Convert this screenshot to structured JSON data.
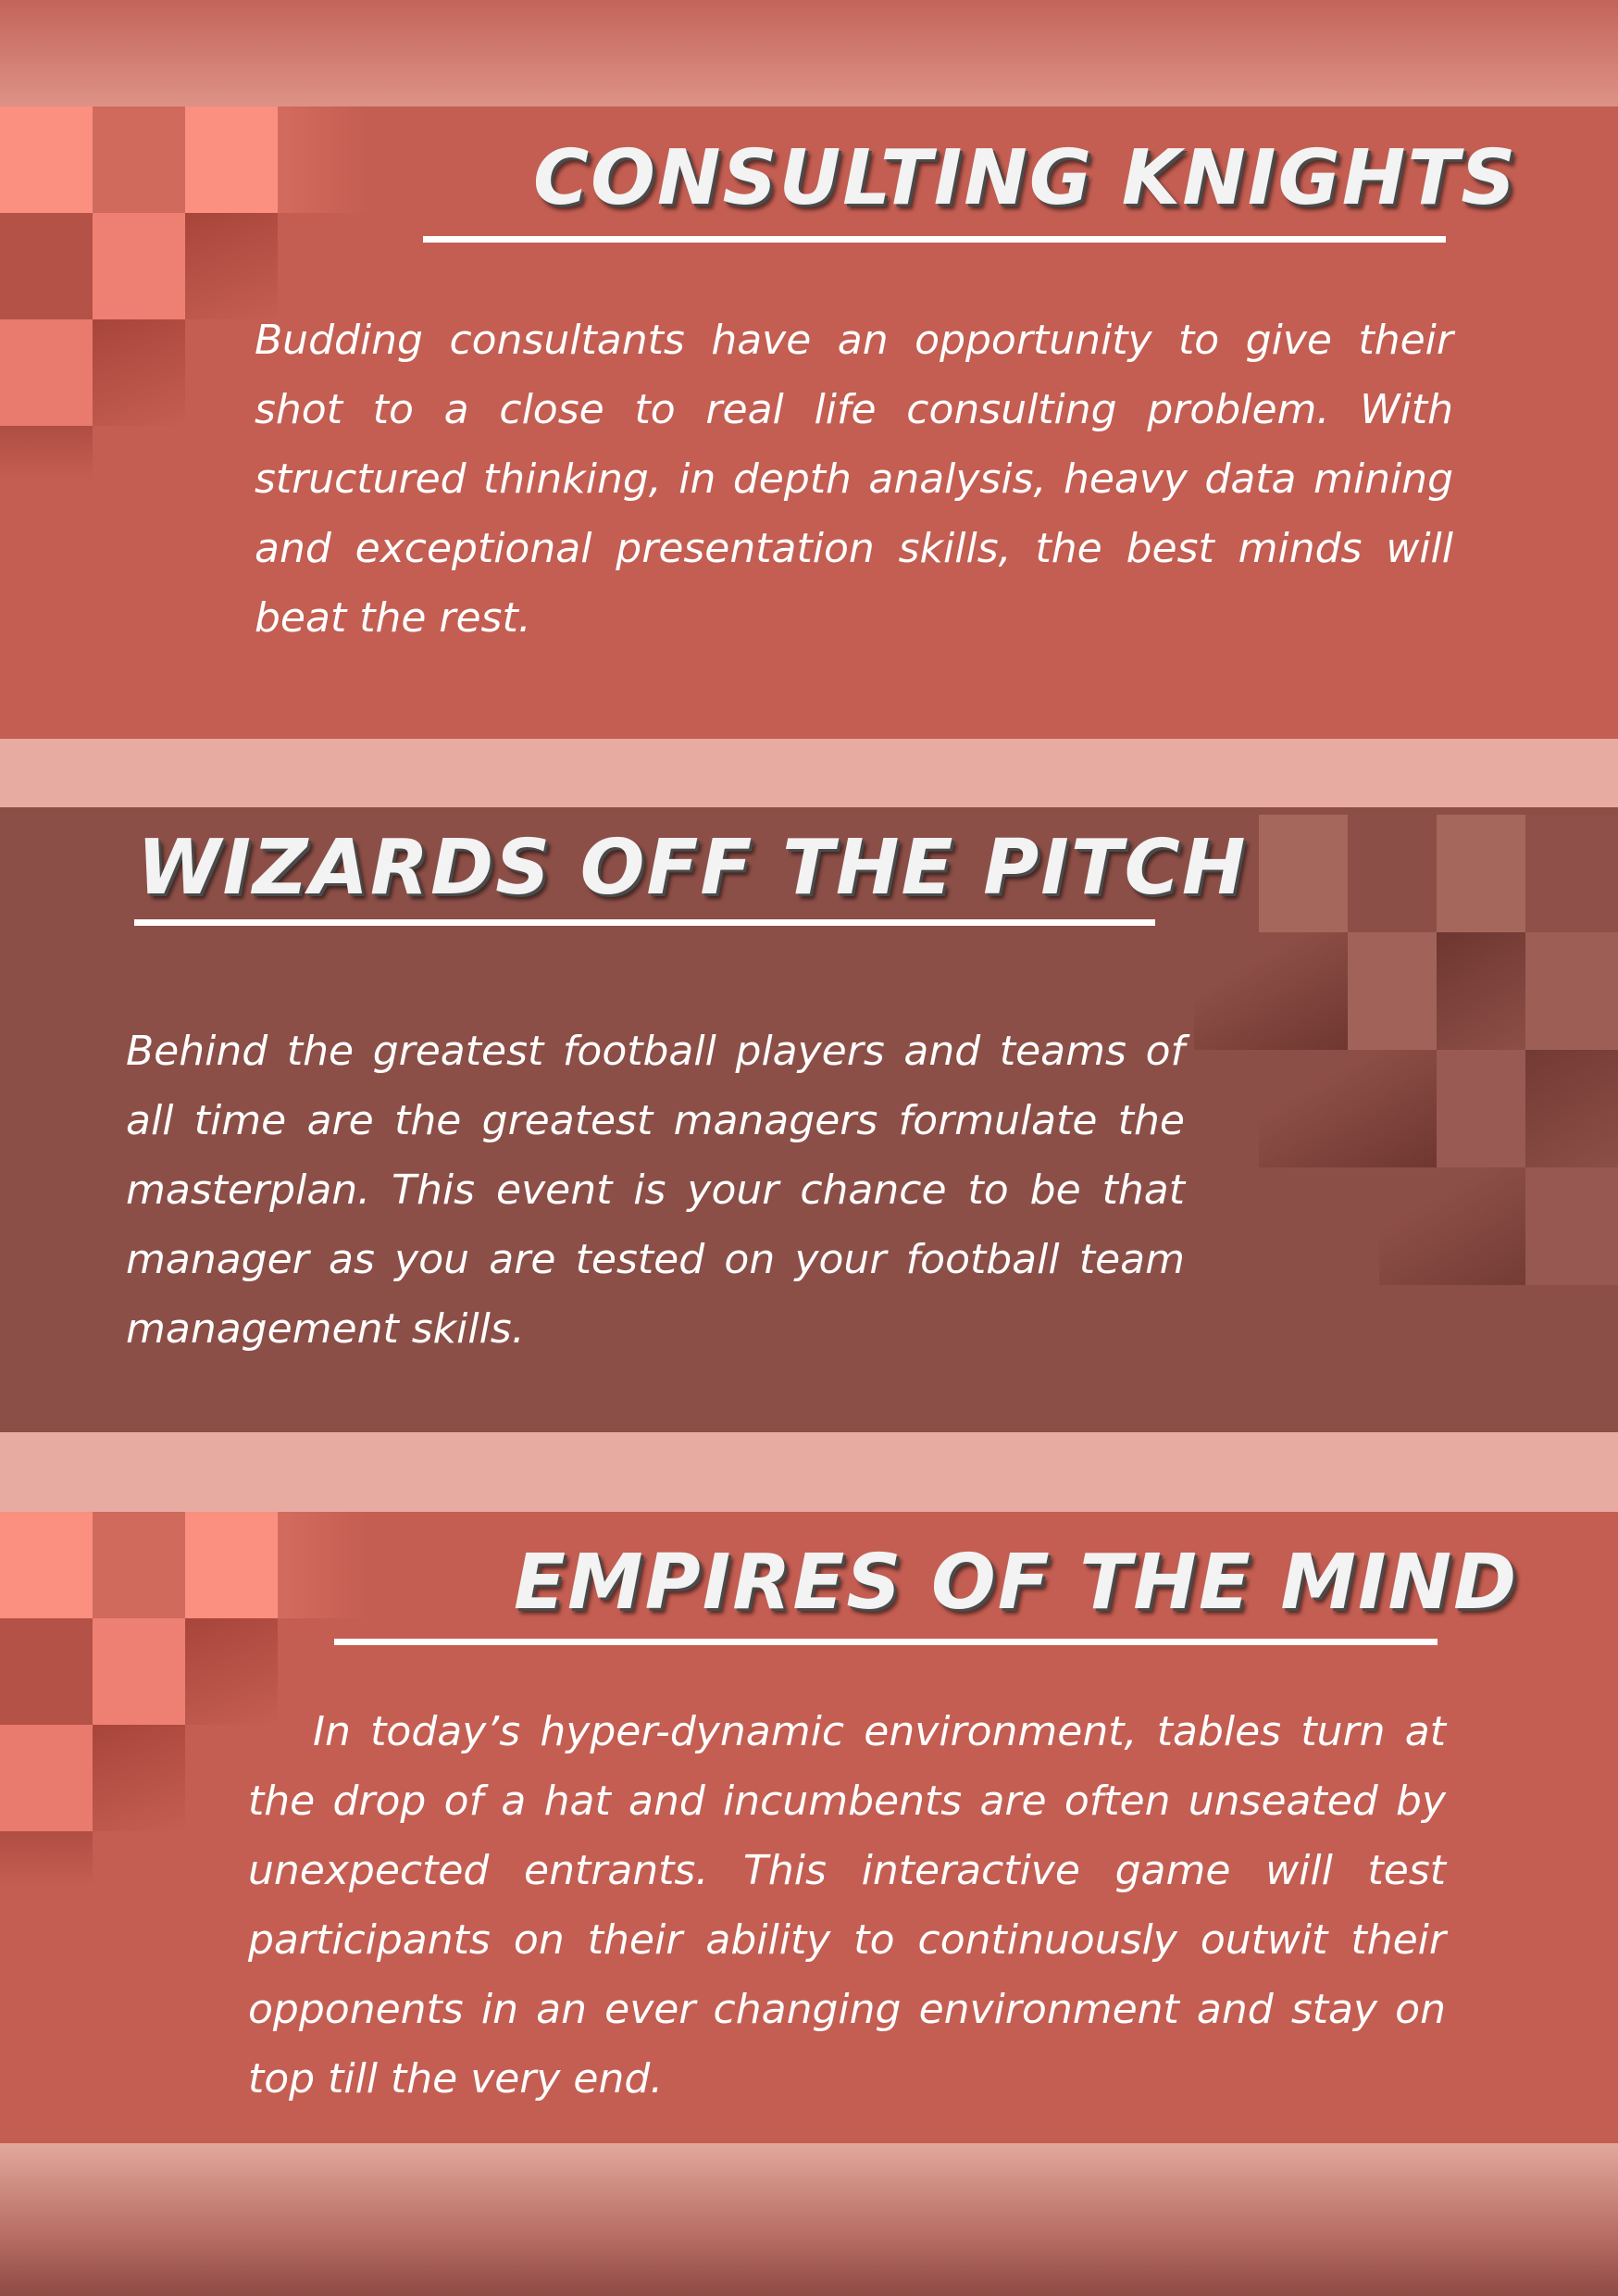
{
  "sections": [
    {
      "title": "CONSULTING KNIGHTS",
      "body": "Budding consultants have an opportunity to give their shot to a close to real life consulting problem. With structured thinking, in depth analysis, heavy data mining and exceptional presentation skills, the best minds will beat the rest."
    },
    {
      "title": "WIZARDS OFF THE PITCH",
      "body": "Behind the greatest football players and teams of all time are the greatest managers formulate the masterplan. This event is your chance to be that manager as you are tested on your football team management skills."
    },
    {
      "title": "EMPIRES OF THE MIND",
      "body": "In today’s hyper-dynamic environment, tables turn at the drop of a hat and incumbents are often unseated by unexpected entrants. This interactive game will test participants on their ability to continuously outwit their opponents in an ever changing environment and stay on top till the very end."
    }
  ],
  "colors": {
    "section_red": "#c45e52",
    "section_brown": "#8c4f47",
    "band_pink": "#e7aba2",
    "tile_light": "#fb8f80",
    "tile_brown": "#a5665c",
    "text": "#ffffff"
  }
}
